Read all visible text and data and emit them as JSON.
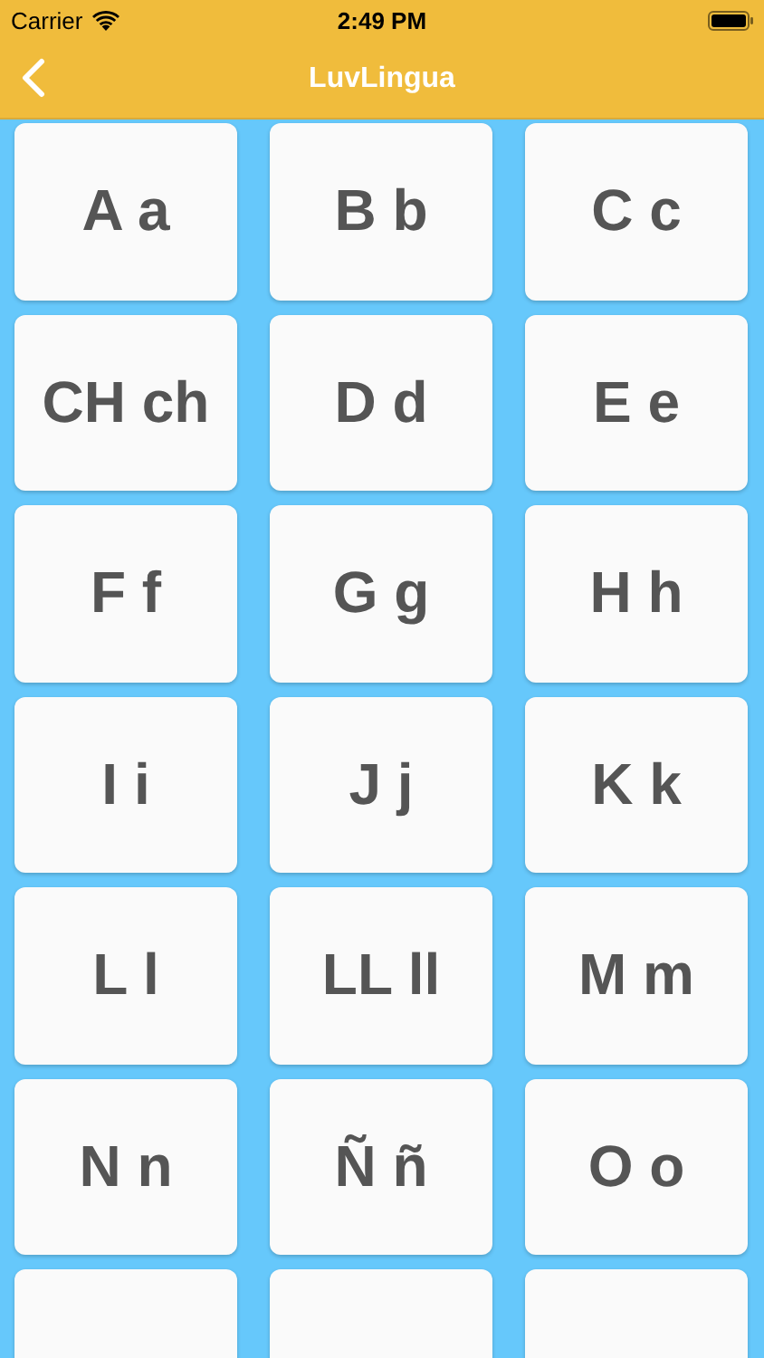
{
  "status_bar": {
    "carrier": "Carrier",
    "time": "2:49 PM"
  },
  "nav_bar": {
    "title": "LuvLingua"
  },
  "letters": [
    {
      "label": "A a"
    },
    {
      "label": "B b"
    },
    {
      "label": "C c"
    },
    {
      "label": "CH ch"
    },
    {
      "label": "D d"
    },
    {
      "label": "E e"
    },
    {
      "label": "F f"
    },
    {
      "label": "G g"
    },
    {
      "label": "H h"
    },
    {
      "label": "I i"
    },
    {
      "label": "J j"
    },
    {
      "label": "K k"
    },
    {
      "label": "L l"
    },
    {
      "label": "LL ll"
    },
    {
      "label": "M m"
    },
    {
      "label": "N n"
    },
    {
      "label": "Ñ ñ"
    },
    {
      "label": "O o"
    },
    {
      "kind": "cut"
    },
    {
      "kind": "cut"
    },
    {
      "kind": "cut"
    }
  ]
}
